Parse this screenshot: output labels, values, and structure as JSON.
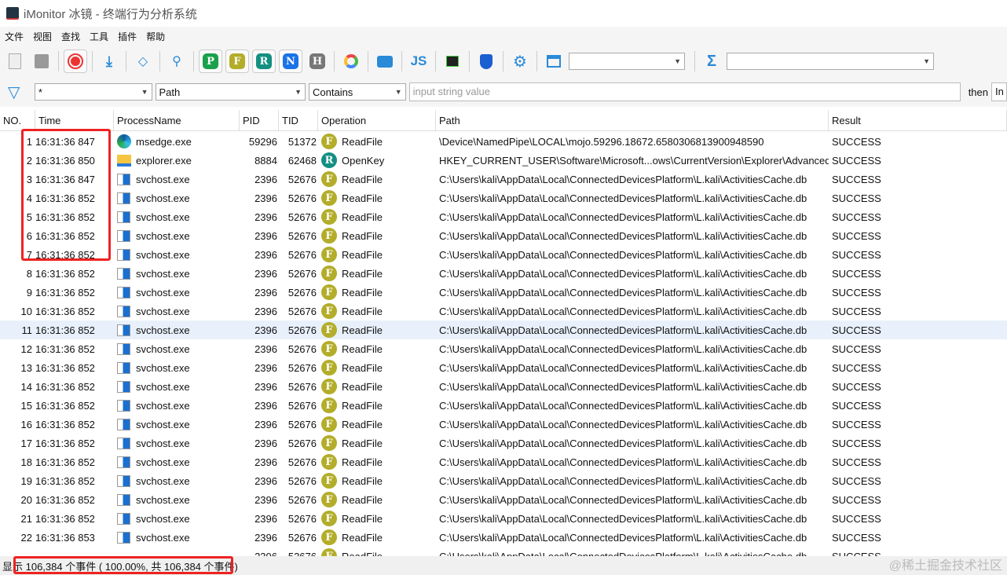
{
  "window": {
    "title": "iMonitor 冰镜 - 终端行为分析系统"
  },
  "menu": [
    "文件",
    "视图",
    "查找",
    "工具",
    "插件",
    "帮助"
  ],
  "toolbar": {
    "badges": [
      "P",
      "F",
      "R",
      "N",
      "H"
    ],
    "js_label": "JS"
  },
  "filter": {
    "column": "*",
    "field": "Path",
    "relation": "Contains",
    "placeholder": "input string value",
    "then_label": "then",
    "trailing": "In"
  },
  "columns": [
    "NO.",
    "Time",
    "ProcessName",
    "PID",
    "TID",
    "Operation",
    "Path",
    "Result"
  ],
  "colors": {
    "F": "#b3ad2a",
    "R": "#138f82",
    "P": "#1aa14a",
    "N": "#1a73e8",
    "H": "#777777",
    "highlight": "#e22222"
  },
  "rows": [
    [
      "1",
      "16:31:36 847",
      "msedge.exe",
      "59296",
      "51372",
      "F",
      "ReadFile",
      "\\Device\\NamedPipe\\LOCAL\\mojo.59296.18672.6580306813900948590",
      "SUCCESS",
      "edge-icon"
    ],
    [
      "2",
      "16:31:36 850",
      "explorer.exe",
      "8884",
      "62468",
      "R",
      "OpenKey",
      "HKEY_CURRENT_USER\\Software\\Microsoft...ows\\CurrentVersion\\Explorer\\Advanced",
      "SUCCESS",
      "folder-icon"
    ],
    [
      "3",
      "16:31:36 847",
      "svchost.exe",
      "2396",
      "52676",
      "F",
      "ReadFile",
      "C:\\Users\\kali\\AppData\\Local\\ConnectedDevicesPlatform\\L.kali\\ActivitiesCache.db",
      "SUCCESS",
      "window-icon"
    ],
    [
      "4",
      "16:31:36 852",
      "svchost.exe",
      "2396",
      "52676",
      "F",
      "ReadFile",
      "C:\\Users\\kali\\AppData\\Local\\ConnectedDevicesPlatform\\L.kali\\ActivitiesCache.db",
      "SUCCESS",
      "window-icon"
    ],
    [
      "5",
      "16:31:36 852",
      "svchost.exe",
      "2396",
      "52676",
      "F",
      "ReadFile",
      "C:\\Users\\kali\\AppData\\Local\\ConnectedDevicesPlatform\\L.kali\\ActivitiesCache.db",
      "SUCCESS",
      "window-icon"
    ],
    [
      "6",
      "16:31:36 852",
      "svchost.exe",
      "2396",
      "52676",
      "F",
      "ReadFile",
      "C:\\Users\\kali\\AppData\\Local\\ConnectedDevicesPlatform\\L.kali\\ActivitiesCache.db",
      "SUCCESS",
      "window-icon"
    ],
    [
      "7",
      "16:31:36 852",
      "svchost.exe",
      "2396",
      "52676",
      "F",
      "ReadFile",
      "C:\\Users\\kali\\AppData\\Local\\ConnectedDevicesPlatform\\L.kali\\ActivitiesCache.db",
      "SUCCESS",
      "window-icon"
    ],
    [
      "8",
      "16:31:36 852",
      "svchost.exe",
      "2396",
      "52676",
      "F",
      "ReadFile",
      "C:\\Users\\kali\\AppData\\Local\\ConnectedDevicesPlatform\\L.kali\\ActivitiesCache.db",
      "SUCCESS",
      "window-icon"
    ],
    [
      "9",
      "16:31:36 852",
      "svchost.exe",
      "2396",
      "52676",
      "F",
      "ReadFile",
      "C:\\Users\\kali\\AppData\\Local\\ConnectedDevicesPlatform\\L.kali\\ActivitiesCache.db",
      "SUCCESS",
      "window-icon"
    ],
    [
      "10",
      "16:31:36 852",
      "svchost.exe",
      "2396",
      "52676",
      "F",
      "ReadFile",
      "C:\\Users\\kali\\AppData\\Local\\ConnectedDevicesPlatform\\L.kali\\ActivitiesCache.db",
      "SUCCESS",
      "window-icon"
    ],
    [
      "11",
      "16:31:36 852",
      "svchost.exe",
      "2396",
      "52676",
      "F",
      "ReadFile",
      "C:\\Users\\kali\\AppData\\Local\\ConnectedDevicesPlatform\\L.kali\\ActivitiesCache.db",
      "SUCCESS",
      "window-icon"
    ],
    [
      "12",
      "16:31:36 852",
      "svchost.exe",
      "2396",
      "52676",
      "F",
      "ReadFile",
      "C:\\Users\\kali\\AppData\\Local\\ConnectedDevicesPlatform\\L.kali\\ActivitiesCache.db",
      "SUCCESS",
      "window-icon"
    ],
    [
      "13",
      "16:31:36 852",
      "svchost.exe",
      "2396",
      "52676",
      "F",
      "ReadFile",
      "C:\\Users\\kali\\AppData\\Local\\ConnectedDevicesPlatform\\L.kali\\ActivitiesCache.db",
      "SUCCESS",
      "window-icon"
    ],
    [
      "14",
      "16:31:36 852",
      "svchost.exe",
      "2396",
      "52676",
      "F",
      "ReadFile",
      "C:\\Users\\kali\\AppData\\Local\\ConnectedDevicesPlatform\\L.kali\\ActivitiesCache.db",
      "SUCCESS",
      "window-icon"
    ],
    [
      "15",
      "16:31:36 852",
      "svchost.exe",
      "2396",
      "52676",
      "F",
      "ReadFile",
      "C:\\Users\\kali\\AppData\\Local\\ConnectedDevicesPlatform\\L.kali\\ActivitiesCache.db",
      "SUCCESS",
      "window-icon"
    ],
    [
      "16",
      "16:31:36 852",
      "svchost.exe",
      "2396",
      "52676",
      "F",
      "ReadFile",
      "C:\\Users\\kali\\AppData\\Local\\ConnectedDevicesPlatform\\L.kali\\ActivitiesCache.db",
      "SUCCESS",
      "window-icon"
    ],
    [
      "17",
      "16:31:36 852",
      "svchost.exe",
      "2396",
      "52676",
      "F",
      "ReadFile",
      "C:\\Users\\kali\\AppData\\Local\\ConnectedDevicesPlatform\\L.kali\\ActivitiesCache.db",
      "SUCCESS",
      "window-icon"
    ],
    [
      "18",
      "16:31:36 852",
      "svchost.exe",
      "2396",
      "52676",
      "F",
      "ReadFile",
      "C:\\Users\\kali\\AppData\\Local\\ConnectedDevicesPlatform\\L.kali\\ActivitiesCache.db",
      "SUCCESS",
      "window-icon"
    ],
    [
      "19",
      "16:31:36 852",
      "svchost.exe",
      "2396",
      "52676",
      "F",
      "ReadFile",
      "C:\\Users\\kali\\AppData\\Local\\ConnectedDevicesPlatform\\L.kali\\ActivitiesCache.db",
      "SUCCESS",
      "window-icon"
    ],
    [
      "20",
      "16:31:36 852",
      "svchost.exe",
      "2396",
      "52676",
      "F",
      "ReadFile",
      "C:\\Users\\kali\\AppData\\Local\\ConnectedDevicesPlatform\\L.kali\\ActivitiesCache.db",
      "SUCCESS",
      "window-icon"
    ],
    [
      "21",
      "16:31:36 852",
      "svchost.exe",
      "2396",
      "52676",
      "F",
      "ReadFile",
      "C:\\Users\\kali\\AppData\\Local\\ConnectedDevicesPlatform\\L.kali\\ActivitiesCache.db",
      "SUCCESS",
      "window-icon"
    ],
    [
      "22",
      "16:31:36 853",
      "svchost.exe",
      "2396",
      "52676",
      "F",
      "ReadFile",
      "C:\\Users\\kali\\AppData\\Local\\ConnectedDevicesPlatform\\L.kali\\ActivitiesCache.db",
      "SUCCESS",
      "window-icon"
    ],
    [
      "",
      "",
      "",
      "2396",
      "52676",
      "F",
      "ReadFile",
      "C:\\Users\\kali\\AppData\\Local\\ConnectedDevicesPlatform\\L.kali\\ActivitiesCache.db",
      "SUCCESS",
      "window-icon"
    ]
  ],
  "selected_row": "11",
  "status": {
    "text": "显示 106,384 个事件 ( 100.00%, 共 106,384 个事件)"
  },
  "watermark": "@稀土掘金技术社区"
}
